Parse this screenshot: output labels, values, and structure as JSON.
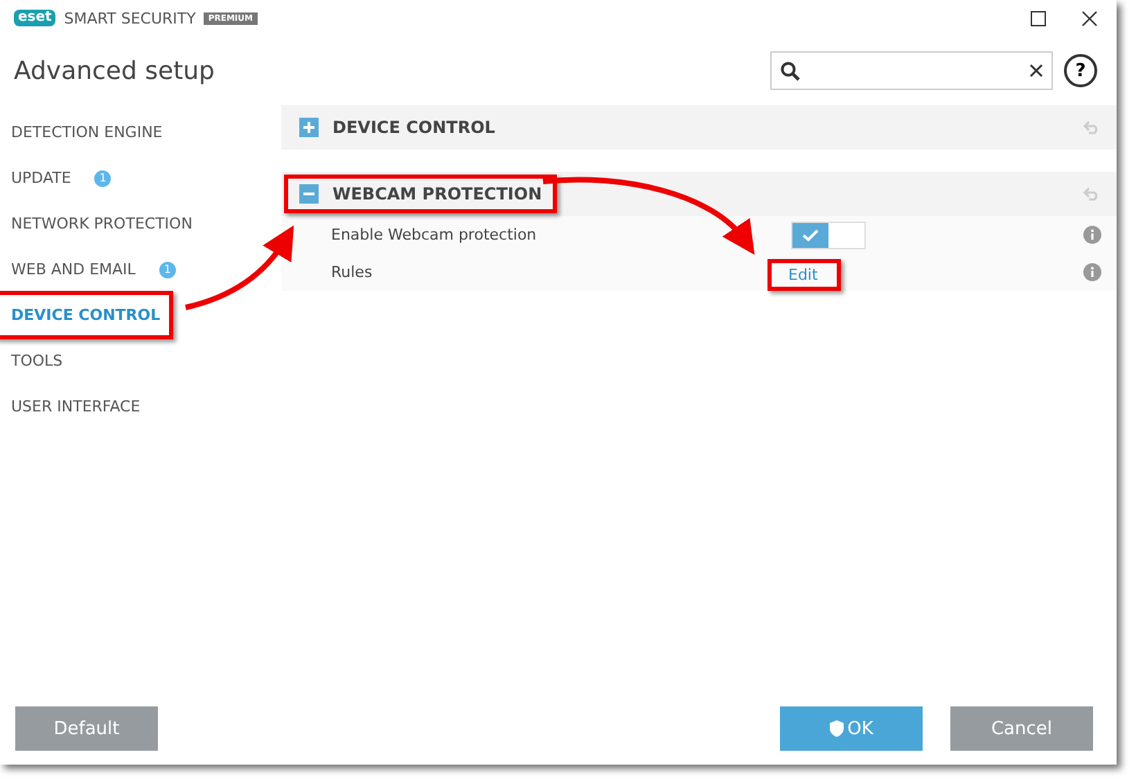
{
  "window": {
    "logo": "eset",
    "product": "SMART SECURITY",
    "edition": "PREMIUM",
    "title": "Advanced setup"
  },
  "help": "?",
  "sidebar": {
    "items": [
      {
        "label": "DETECTION ENGINE",
        "selected": false,
        "highlighted": false
      },
      {
        "label": "UPDATE",
        "selected": false,
        "badge": "1",
        "highlighted": false
      },
      {
        "label": "NETWORK PROTECTION",
        "selected": false,
        "highlighted": false
      },
      {
        "label": "WEB AND EMAIL",
        "selected": false,
        "badge": "1",
        "highlighted": false
      },
      {
        "label": "DEVICE CONTROL",
        "selected": true,
        "highlighted": true
      },
      {
        "label": "TOOLS",
        "selected": false,
        "highlighted": false
      },
      {
        "label": "USER INTERFACE",
        "selected": false,
        "highlighted": false
      }
    ]
  },
  "sections": [
    {
      "title": "DEVICE CONTROL",
      "expanded": false,
      "highlighted": false
    },
    {
      "title": "WEBCAM PROTECTION",
      "expanded": true,
      "highlighted": true,
      "rows": [
        {
          "kind": "toggle",
          "label": "Enable Webcam protection",
          "on": true
        },
        {
          "kind": "link",
          "label": "Rules",
          "link": "Edit",
          "highlighted": true
        }
      ]
    }
  ],
  "buttons": [
    {
      "label": "Default",
      "kind": "secondary"
    },
    {
      "label": "OK",
      "kind": "primary"
    },
    {
      "label": "Cancel",
      "kind": "secondary"
    }
  ]
}
